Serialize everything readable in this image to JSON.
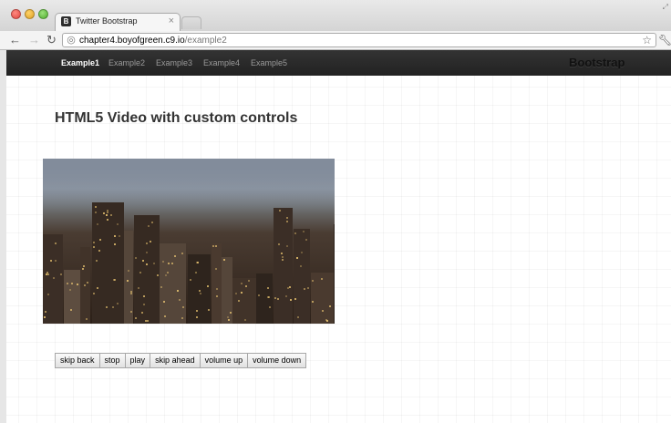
{
  "browser": {
    "tab_title": "Twitter Bootstrap",
    "tab_favicon": "B",
    "url_host": "chapter4.boyofgreen.c9.io",
    "url_path": "/example2",
    "icons": [
      "back-arrow-icon",
      "forward-arrow-icon",
      "reload-icon",
      "globe-icon",
      "star-icon",
      "wrench-icon",
      "close-icon"
    ]
  },
  "navbar": {
    "items": [
      {
        "label": "Example1",
        "active": true
      },
      {
        "label": "Example2",
        "active": false
      },
      {
        "label": "Example3",
        "active": false
      },
      {
        "label": "Example4",
        "active": false
      },
      {
        "label": "Example5",
        "active": false
      }
    ],
    "brand": "Bootstrap"
  },
  "main": {
    "title": "HTML5 Video with custom controls",
    "controls": [
      {
        "label": "skip back"
      },
      {
        "label": "stop"
      },
      {
        "label": "play"
      },
      {
        "label": "skip ahead"
      },
      {
        "label": "volume up"
      },
      {
        "label": "volume down"
      }
    ]
  },
  "colors": {
    "navbar_bg": "#222222",
    "nav_active": "#ffffff",
    "nav_inactive": "#9a9a9a",
    "title_text": "#333333"
  }
}
